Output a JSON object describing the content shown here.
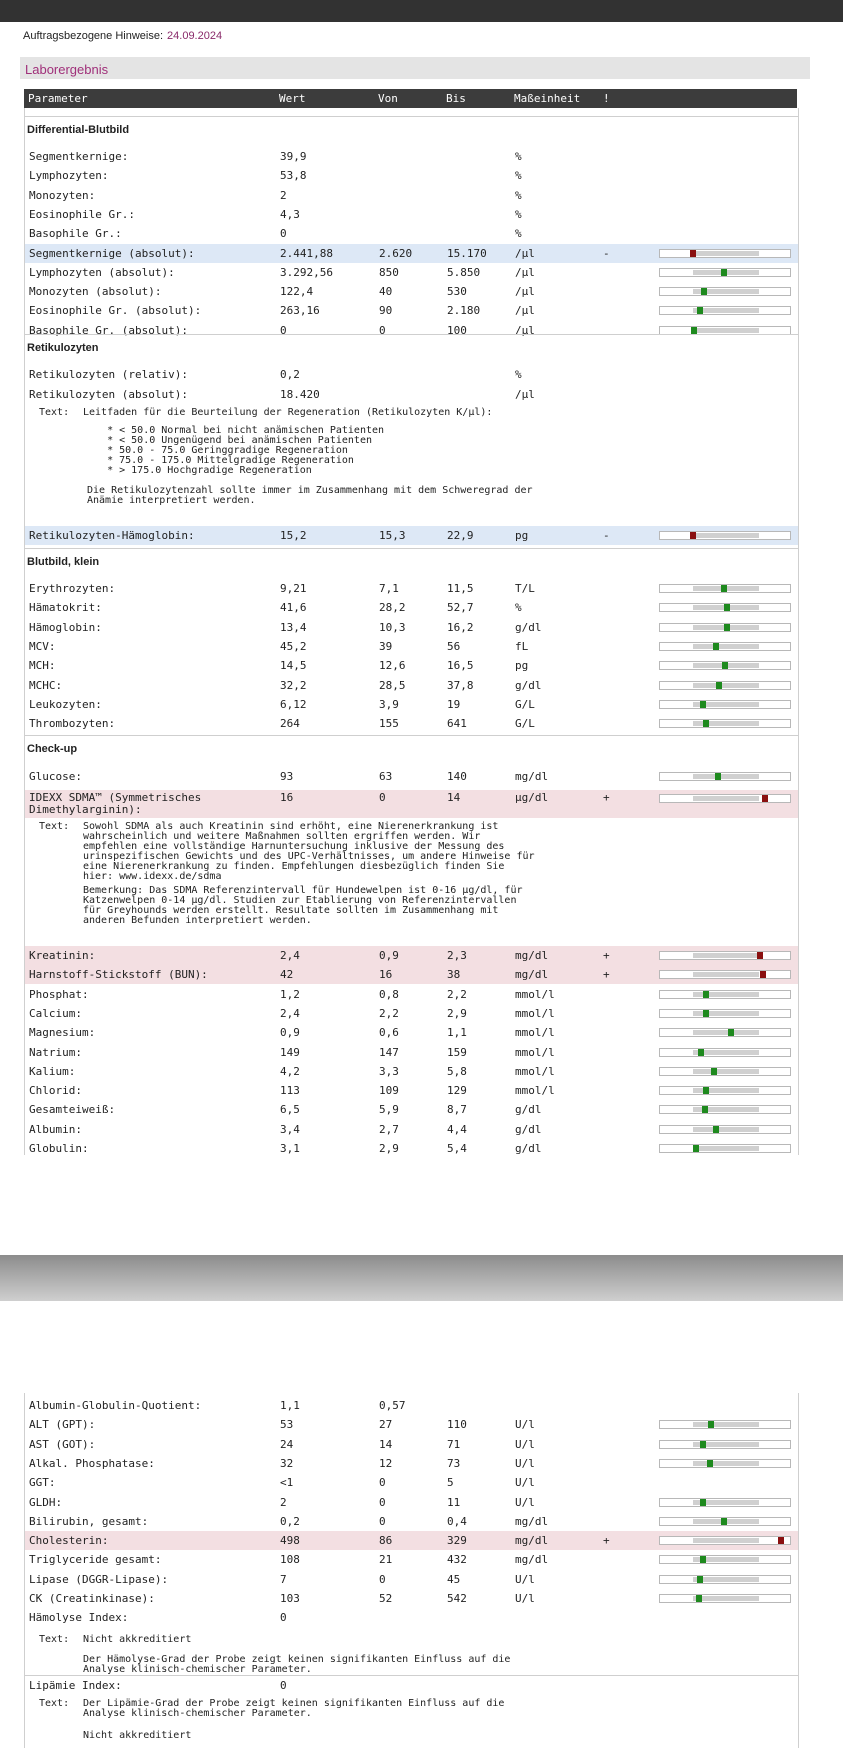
{
  "header": {
    "label": "Auftragsbezogene Hinweise:",
    "date": "24.09.2024"
  },
  "section_title": "Laborergebnis",
  "columns": {
    "param": "Parameter",
    "wert": "Wert",
    "von": "Von",
    "bis": "Bis",
    "unit": "Maßeinheit",
    "flag": "!"
  },
  "groups": {
    "diff": "Differential-Blutbild",
    "retic": "Retikulozyten",
    "bb": "Blutbild, klein",
    "check": "Check-up"
  },
  "diff_rows": [
    {
      "name": "Segmentkernige:",
      "val": "39,9",
      "von": "",
      "bis": "",
      "unit": "%",
      "flag": ""
    },
    {
      "name": "Lymphozyten:",
      "val": "53,8",
      "von": "",
      "bis": "",
      "unit": "%",
      "flag": ""
    },
    {
      "name": "Monozyten:",
      "val": "2",
      "von": "",
      "bis": "",
      "unit": "%",
      "flag": ""
    },
    {
      "name": "Eosinophile Gr.:",
      "val": "4,3",
      "von": "",
      "bis": "",
      "unit": "%",
      "flag": ""
    },
    {
      "name": "Basophile Gr.:",
      "val": "0",
      "von": "",
      "bis": "",
      "unit": "%",
      "flag": ""
    },
    {
      "name": "Segmentkernige (absolut):",
      "val": "2.441,88",
      "von": "2.620",
      "bis": "15.170",
      "unit": "/µl",
      "flag": "-",
      "level": 0.24
    },
    {
      "name": "Lymphozyten (absolut):",
      "val": "3.292,56",
      "von": "850",
      "bis": "5.850",
      "unit": "/µl",
      "flag": "",
      "level": 0.49
    },
    {
      "name": "Monozyten (absolut):",
      "val": "122,4",
      "von": "40",
      "bis": "530",
      "unit": "/µl",
      "flag": "",
      "level": 0.33
    },
    {
      "name": "Eosinophile Gr. (absolut):",
      "val": "263,16",
      "von": "90",
      "bis": "2.180",
      "unit": "/µl",
      "flag": "",
      "level": 0.3
    },
    {
      "name": "Basophile Gr. (absolut):",
      "val": "0",
      "von": "0",
      "bis": "100",
      "unit": "/µl",
      "flag": "",
      "level": 0.25
    }
  ],
  "retic_rows": [
    {
      "name": "Retikulozyten (relativ):",
      "val": "0,2",
      "von": "",
      "bis": "",
      "unit": "%",
      "flag": ""
    },
    {
      "name": "Retikulozyten (absolut):",
      "val": "18.420",
      "von": "",
      "bis": "",
      "unit": "/µl",
      "flag": ""
    }
  ],
  "retic_text": {
    "label": "Text:",
    "line1": "Leitfaden für die Beurteilung der Regeneration (Retikulozyten K/µl):",
    "bullets": "    * < 50.0 Normal bei nicht anämischen Patienten\n    * < 50.0 Ungenügend bei anämischen Patienten\n    * 50.0 - 75.0 Geringgradige Regeneration\n    * 75.0 - 175.0 Mittelgradige Regeneration\n    * > 175.0 Hochgradige Regeneration",
    "note": "Die Retikulozytenzahl sollte immer im Zusammenhang mit dem Schweregrad der\nAnämie interpretiert werden."
  },
  "retic_hb": {
    "name": "Retikulozyten-Hämoglobin:",
    "val": "15,2",
    "von": "15,3",
    "bis": "22,9",
    "unit": "pg",
    "flag": "-",
    "level": 0.24
  },
  "bb_rows": [
    {
      "name": "Erythrozyten:",
      "val": "9,21",
      "von": "7,1",
      "bis": "11,5",
      "unit": "T/L",
      "flag": "",
      "level": 0.49
    },
    {
      "name": "Hämatokrit:",
      "val": "41,6",
      "von": "28,2",
      "bis": "52,7",
      "unit": "%",
      "flag": "",
      "level": 0.52
    },
    {
      "name": "Hämoglobin:",
      "val": "13,4",
      "von": "10,3",
      "bis": "16,2",
      "unit": "g/dl",
      "flag": "",
      "level": 0.52
    },
    {
      "name": "MCV:",
      "val": "45,2",
      "von": "39",
      "bis": "56",
      "unit": "fL",
      "flag": "",
      "level": 0.43
    },
    {
      "name": "MCH:",
      "val": "14,5",
      "von": "12,6",
      "bis": "16,5",
      "unit": "pg",
      "flag": "",
      "level": 0.5
    },
    {
      "name": "MCHC:",
      "val": "32,2",
      "von": "28,5",
      "bis": "37,8",
      "unit": "g/dl",
      "flag": "",
      "level": 0.45
    },
    {
      "name": "Leukozyten:",
      "val": "6,12",
      "von": "3,9",
      "bis": "19",
      "unit": "G/L",
      "flag": "",
      "level": 0.32
    },
    {
      "name": "Thrombozyten:",
      "val": "264",
      "von": "155",
      "bis": "641",
      "unit": "G/L",
      "flag": "",
      "level": 0.35
    }
  ],
  "check_rows_a": [
    {
      "name": "Glucose:",
      "val": "93",
      "von": "63",
      "bis": "140",
      "unit": "mg/dl",
      "flag": "",
      "level": 0.44
    }
  ],
  "sdma": {
    "name1": "IDEXX SDMA™ (Symmetrisches",
    "name2": "Dimethylarginin):",
    "val": "16",
    "von": "0",
    "bis": "14",
    "unit": "µg/dl",
    "flag": "+",
    "level": 0.82
  },
  "sdma_text": {
    "label": "Text:",
    "p1": "Sowohl SDMA als auch Kreatinin sind erhöht, eine Nierenerkrankung ist\nwahrscheinlich und weitere Maßnahmen sollten ergriffen werden. Wir\nempfehlen eine vollständige Harnuntersuchung inklusive der Messung des\nurinspezifischen Gewichts und des UPC-Verhältnisses, um andere Hinweise für\neine Nierenerkrankung zu finden. Empfehlungen diesbezüglich finden Sie\nhier: www.idexx.de/sdma",
    "p2": "Bemerkung: Das SDMA Referenzintervall für Hundewelpen ist 0-16 µg/dl, für\nKatzenwelpen 0-14 µg/dl. Studien zur Etablierung von Referenzintervallen\nfür Greyhounds werden erstellt. Resultate sollten im Zusammenhang mit\nanderen Befunden interpretiert werden."
  },
  "check_rows_b": [
    {
      "name": "Kreatinin:",
      "val": "2,4",
      "von": "0,9",
      "bis": "2,3",
      "unit": "mg/dl",
      "flag": "+",
      "level": 0.78,
      "hl": "pink"
    },
    {
      "name": "Harnstoff-Stickstoff (BUN):",
      "val": "42",
      "von": "16",
      "bis": "38",
      "unit": "mg/dl",
      "flag": "+",
      "level": 0.81,
      "hl": "pink"
    },
    {
      "name": "Phosphat:",
      "val": "1,2",
      "von": "0,8",
      "bis": "2,2",
      "unit": "mmol/l",
      "flag": "",
      "level": 0.35
    },
    {
      "name": "Calcium:",
      "val": "2,4",
      "von": "2,2",
      "bis": "2,9",
      "unit": "mmol/l",
      "flag": "",
      "level": 0.35
    },
    {
      "name": "Magnesium:",
      "val": "0,9",
      "von": "0,6",
      "bis": "1,1",
      "unit": "mmol/l",
      "flag": "",
      "level": 0.55
    },
    {
      "name": "Natrium:",
      "val": "149",
      "von": "147",
      "bis": "159",
      "unit": "mmol/l",
      "flag": "",
      "level": 0.31
    },
    {
      "name": "Kalium:",
      "val": "4,2",
      "von": "3,3",
      "bis": "5,8",
      "unit": "mmol/l",
      "flag": "",
      "level": 0.41
    },
    {
      "name": "Chlorid:",
      "val": "113",
      "von": "109",
      "bis": "129",
      "unit": "mmol/l",
      "flag": "",
      "level": 0.35
    },
    {
      "name": "Gesamteiweiß:",
      "val": "6,5",
      "von": "5,9",
      "bis": "8,7",
      "unit": "g/dl",
      "flag": "",
      "level": 0.34
    },
    {
      "name": "Albumin:",
      "val": "3,4",
      "von": "2,7",
      "bis": "4,4",
      "unit": "g/dl",
      "flag": "",
      "level": 0.43
    },
    {
      "name": "Globulin:",
      "val": "3,1",
      "von": "2,9",
      "bis": "5,4",
      "unit": "g/dl",
      "flag": "",
      "level": 0.27
    }
  ],
  "page2_rows": [
    {
      "name": "Albumin-Globulin-Quotient:",
      "val": "1,1",
      "von": "0,57",
      "bis": "",
      "unit": "",
      "flag": ""
    },
    {
      "name": "ALT (GPT):",
      "val": "53",
      "von": "27",
      "bis": "110",
      "unit": "U/l",
      "flag": "",
      "level": 0.39
    },
    {
      "name": "AST (GOT):",
      "val": "24",
      "von": "14",
      "bis": "71",
      "unit": "U/l",
      "flag": "",
      "level": 0.32
    },
    {
      "name": "Alkal. Phosphatase:",
      "val": "32",
      "von": "12",
      "bis": "73",
      "unit": "U/l",
      "flag": "",
      "level": 0.38
    },
    {
      "name": "GGT:",
      "val": "<1",
      "von": "0",
      "bis": "5",
      "unit": "U/l",
      "flag": ""
    },
    {
      "name": "GLDH:",
      "val": "2",
      "von": "0",
      "bis": "11",
      "unit": "U/l",
      "flag": "",
      "level": 0.32
    },
    {
      "name": "Bilirubin, gesamt:",
      "val": "0,2",
      "von": "0",
      "bis": "0,4",
      "unit": "mg/dl",
      "flag": "",
      "level": 0.49
    },
    {
      "name": "Cholesterin:",
      "val": "498",
      "von": "86",
      "bis": "329",
      "unit": "mg/dl",
      "flag": "+",
      "level": 0.95,
      "hl": "pink"
    },
    {
      "name": "Triglyceride gesamt:",
      "val": "108",
      "von": "21",
      "bis": "432",
      "unit": "mg/dl",
      "flag": "",
      "level": 0.32
    },
    {
      "name": "Lipase (DGGR-Lipase):",
      "val": "7",
      "von": "0",
      "bis": "45",
      "unit": "U/l",
      "flag": "",
      "level": 0.3
    },
    {
      "name": "CK (Creatinkinase):",
      "val": "103",
      "von": "52",
      "bis": "542",
      "unit": "U/l",
      "flag": "",
      "level": 0.29
    },
    {
      "name": "Hämolyse Index:",
      "val": "0",
      "von": "",
      "bis": "",
      "unit": "",
      "flag": ""
    }
  ],
  "hemolysis_text": {
    "label": "Text:",
    "line1": "Nicht akkreditiert",
    "p": "Der Hämolyse-Grad der Probe zeigt keinen signifikanten Einfluss auf die\nAnalyse klinisch-chemischer Parameter."
  },
  "lipemia_row": {
    "name": "Lipämie Index:",
    "val": "0"
  },
  "lipemia_text": {
    "label": "Text:",
    "p": "Der Lipämie-Grad der Probe zeigt keinen signifikanten Einfluss auf die\nAnalyse klinisch-chemischer Parameter.",
    "note": "Nicht akkreditiert"
  },
  "colors": {
    "ok": "#1e8a1e",
    "bad": "#8a1010",
    "accent": "#a0307a"
  }
}
